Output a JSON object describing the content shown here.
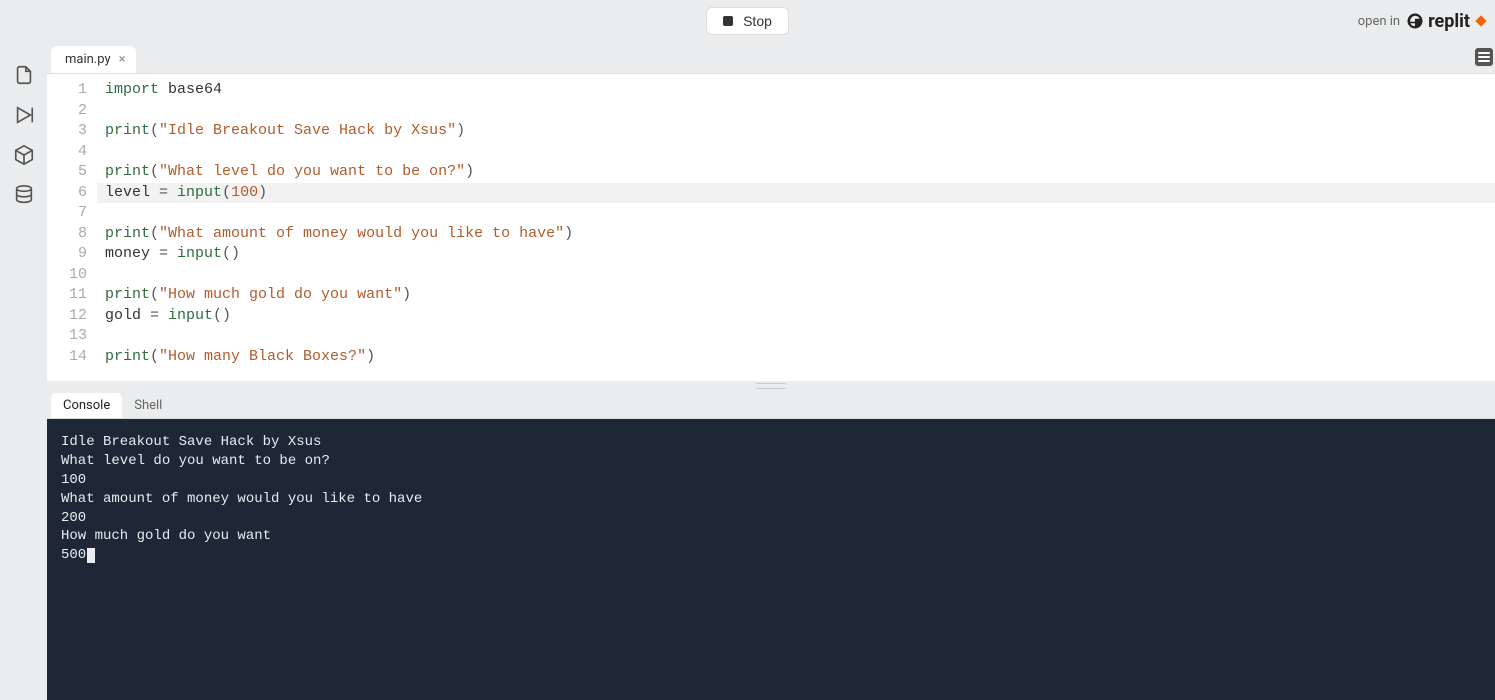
{
  "topbar": {
    "stop_label": "Stop",
    "open_in_label": "open in",
    "brand": "replit"
  },
  "tabs": {
    "file": "main.py"
  },
  "editor": {
    "lines": [
      {
        "n": "1",
        "tokens": [
          {
            "t": "import ",
            "c": "kw"
          },
          {
            "t": "base64",
            "c": "id"
          }
        ]
      },
      {
        "n": "2",
        "tokens": []
      },
      {
        "n": "3",
        "tokens": [
          {
            "t": "print",
            "c": "fn"
          },
          {
            "t": "(",
            "c": "punct"
          },
          {
            "t": "\"Idle Breakout Save Hack by Xsus\"",
            "c": "str"
          },
          {
            "t": ")",
            "c": "punct"
          }
        ]
      },
      {
        "n": "4",
        "tokens": []
      },
      {
        "n": "5",
        "tokens": [
          {
            "t": "print",
            "c": "fn"
          },
          {
            "t": "(",
            "c": "punct"
          },
          {
            "t": "\"What level do you want to be on?\"",
            "c": "str"
          },
          {
            "t": ")",
            "c": "punct"
          }
        ]
      },
      {
        "n": "6",
        "hl": true,
        "tokens": [
          {
            "t": "level ",
            "c": "id"
          },
          {
            "t": "= ",
            "c": "punct"
          },
          {
            "t": "input",
            "c": "fn"
          },
          {
            "t": "(",
            "c": "punct"
          },
          {
            "t": "100",
            "c": "num"
          },
          {
            "t": ")",
            "c": "punct"
          }
        ]
      },
      {
        "n": "7",
        "tokens": []
      },
      {
        "n": "8",
        "tokens": [
          {
            "t": "print",
            "c": "fn"
          },
          {
            "t": "(",
            "c": "punct"
          },
          {
            "t": "\"What amount of money would you like to have\"",
            "c": "str"
          },
          {
            "t": ")",
            "c": "punct"
          }
        ]
      },
      {
        "n": "9",
        "tokens": [
          {
            "t": "money ",
            "c": "id"
          },
          {
            "t": "= ",
            "c": "punct"
          },
          {
            "t": "input",
            "c": "fn"
          },
          {
            "t": "()",
            "c": "punct"
          }
        ]
      },
      {
        "n": "10",
        "tokens": []
      },
      {
        "n": "11",
        "tokens": [
          {
            "t": "print",
            "c": "fn"
          },
          {
            "t": "(",
            "c": "punct"
          },
          {
            "t": "\"How much gold do you want\"",
            "c": "str"
          },
          {
            "t": ")",
            "c": "punct"
          }
        ]
      },
      {
        "n": "12",
        "tokens": [
          {
            "t": "gold ",
            "c": "id"
          },
          {
            "t": "= ",
            "c": "punct"
          },
          {
            "t": "input",
            "c": "fn"
          },
          {
            "t": "()",
            "c": "punct"
          }
        ]
      },
      {
        "n": "13",
        "tokens": []
      },
      {
        "n": "14",
        "tokens": [
          {
            "t": "print",
            "c": "fn"
          },
          {
            "t": "(",
            "c": "punct"
          },
          {
            "t": "\"How many Black Boxes?\"",
            "c": "str"
          },
          {
            "t": ")",
            "c": "punct"
          }
        ]
      }
    ]
  },
  "console_tabs": {
    "console": "Console",
    "shell": "Shell"
  },
  "console": {
    "lines": [
      "Idle Breakout Save Hack by Xsus",
      "What level do you want to be on?",
      "100",
      "What amount of money would you like to have",
      "200",
      "How much gold do you want",
      "500"
    ]
  }
}
